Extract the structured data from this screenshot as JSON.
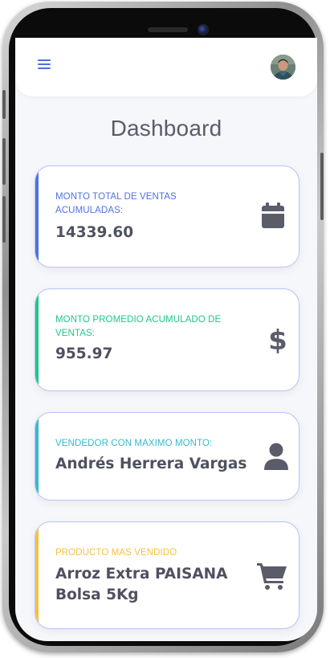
{
  "header": {
    "menu_icon": "hamburger-menu-icon",
    "avatar_icon": "user-avatar-photo"
  },
  "page": {
    "title": "Dashboard"
  },
  "cards": [
    {
      "label": "MONTO TOTAL DE VENTAS ACUMULADAS:",
      "value": "14339.60",
      "icon": "calendar-icon",
      "accent_color": "#4e73df"
    },
    {
      "label": "MONTO PROMEDIO ACUMULADO DE VENTAS:",
      "value": "955.97",
      "icon": "dollar-icon",
      "accent_color": "#1cc88a"
    },
    {
      "label": "VENDEDOR CON MAXIMO MONTO:",
      "value": "Andrés Herrera Vargas",
      "icon": "user-icon",
      "accent_color": "#36b9cc"
    },
    {
      "label": "PRODUCTO MAS VENDIDO",
      "value": "Arroz Extra PAISANA Bolsa 5Kg",
      "icon": "shopping-cart-icon",
      "accent_color": "#f6c23e"
    }
  ],
  "colors": {
    "primary": "#4e73df",
    "success": "#1cc88a",
    "info": "#36b9cc",
    "warning": "#f6c23e",
    "text_dark": "#5a5c69",
    "icon_gray": "#5a5c69",
    "card_border": "#b7c4f2"
  }
}
